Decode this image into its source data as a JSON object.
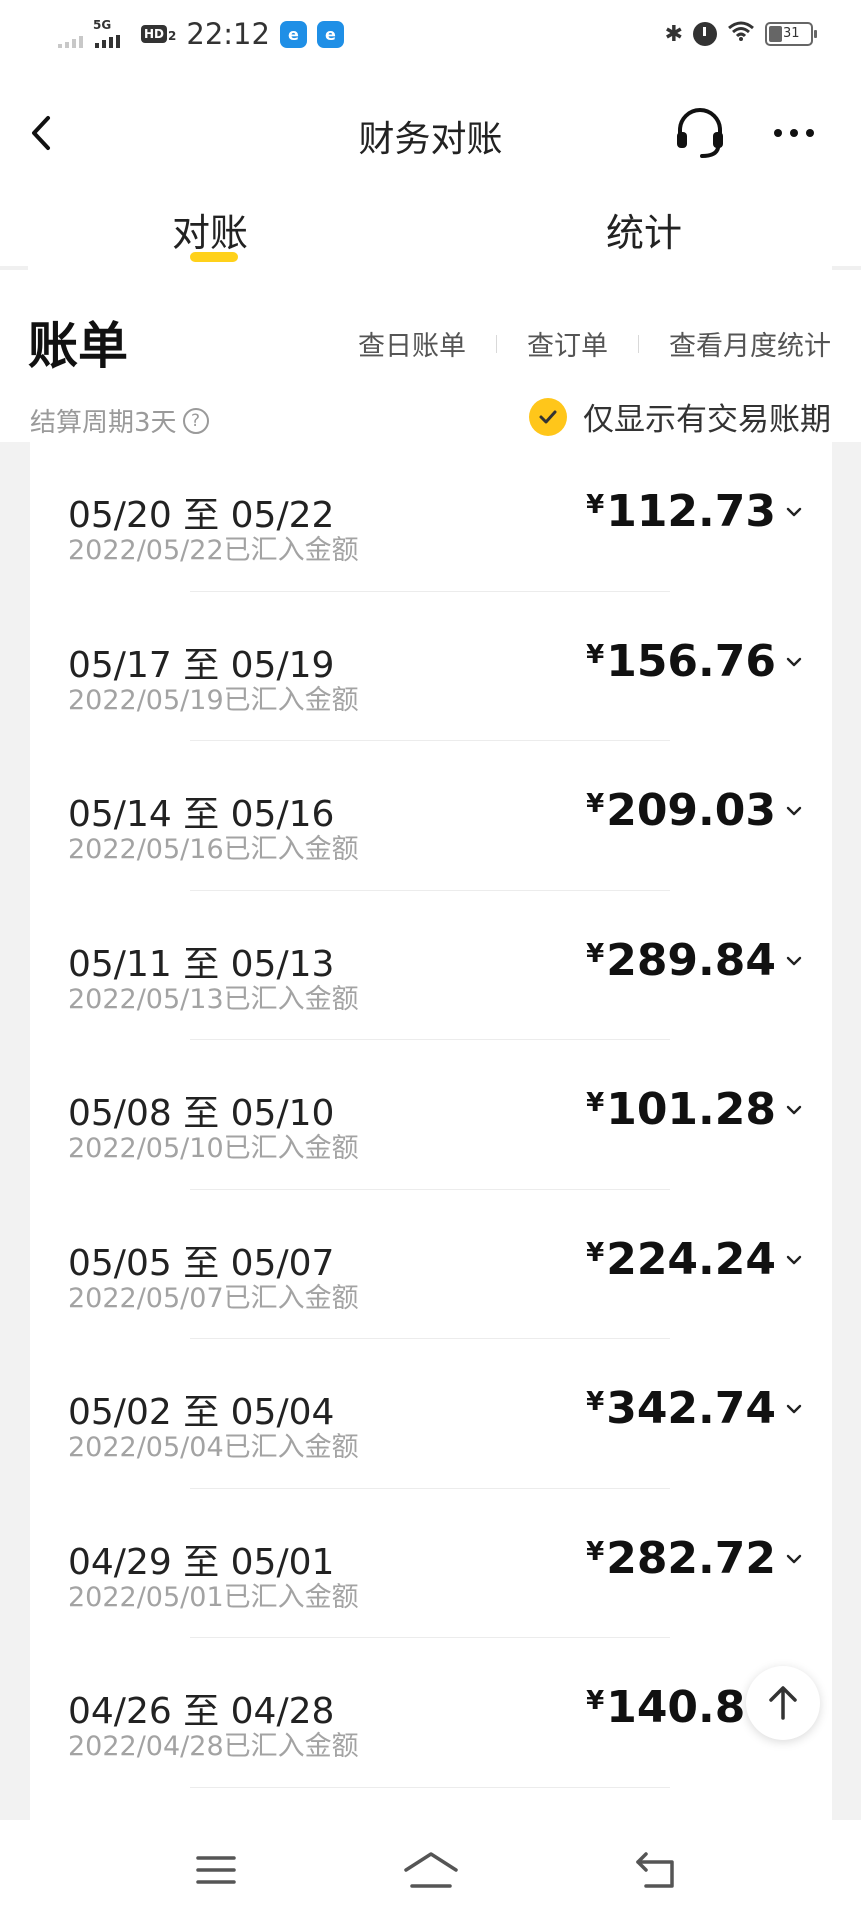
{
  "status_bar": {
    "network": "5G",
    "hd_label": "HD",
    "hd_sub": "2",
    "time": "22:12",
    "app_icon_1": "e",
    "app_icon_2": "e",
    "battery": "31"
  },
  "nav": {
    "title": "财务对账",
    "icons": [
      "back-icon",
      "headset-icon",
      "more-icon"
    ]
  },
  "tabs": [
    {
      "label": "对账",
      "active": true
    },
    {
      "label": "统计",
      "active": false
    }
  ],
  "bill": {
    "title": "账单",
    "links": [
      "查日账单",
      "查订单",
      "查看月度统计"
    ],
    "cycle_text": "结算周期3天",
    "help_icon": "?",
    "filter_label": "仅显示有交易账期",
    "filter_checked": true
  },
  "currency_symbol": "¥",
  "rows": [
    {
      "range": "05/20 至 05/22",
      "credited": "2022/05/22已汇入金额",
      "amount": "112.73"
    },
    {
      "range": "05/17 至 05/19",
      "credited": "2022/05/19已汇入金额",
      "amount": "156.76"
    },
    {
      "range": "05/14 至 05/16",
      "credited": "2022/05/16已汇入金额",
      "amount": "209.03"
    },
    {
      "range": "05/11 至 05/13",
      "credited": "2022/05/13已汇入金额",
      "amount": "289.84"
    },
    {
      "range": "05/08 至 05/10",
      "credited": "2022/05/10已汇入金额",
      "amount": "101.28"
    },
    {
      "range": "05/05 至 05/07",
      "credited": "2022/05/07已汇入金额",
      "amount": "224.24"
    },
    {
      "range": "05/02 至 05/04",
      "credited": "2022/05/04已汇入金额",
      "amount": "342.74"
    },
    {
      "range": "04/29 至 05/01",
      "credited": "2022/05/01已汇入金额",
      "amount": "282.72"
    },
    {
      "range": "04/26 至 04/28",
      "credited": "2022/04/28已汇入金额",
      "amount": "140.80"
    }
  ],
  "colors": {
    "accent": "#ffd11a",
    "check": "#ffc61a",
    "muted_text": "#a3a3a3"
  },
  "system_nav": [
    "menu-icon",
    "home-icon",
    "back-nav-icon"
  ]
}
